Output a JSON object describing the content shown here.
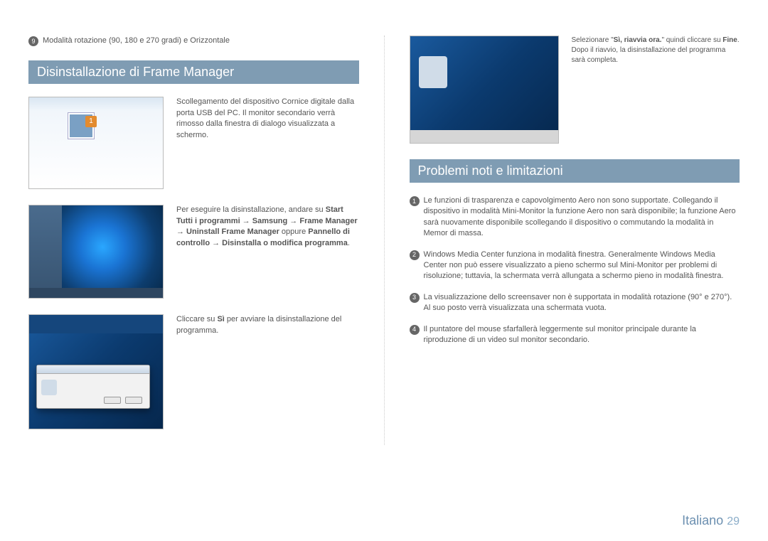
{
  "left": {
    "rotation_item": {
      "num": "9",
      "text": "Modalità rotazione (90, 180 e 270 gradi) e Orizzontale"
    },
    "section_title": "Disinstallazione di Frame Manager",
    "row1_text": "Scollegamento del dispositivo Cornice digitale dalla porta USB del PC. Il monitor secondario verrà rimosso dalla finestra di dialogo visualizzata a schermo.",
    "row2_plain1": "Per eseguire la disinstallazione, andare su ",
    "row2_bold1": "Start Tutti i programmi → Samsung → Frame Manager → Uninstall Frame Manager",
    "row2_plain2": " oppure ",
    "row2_bold2": "Pannello di controllo → Disinstalla o modifica programma",
    "row2_plain3": ".",
    "row3_plain1": "Cliccare su ",
    "row3_bold1": "Sì",
    "row3_plain2": " per avviare la disinstallazione del programma."
  },
  "right": {
    "top_plain1": "Selezionare \"",
    "top_bold1": "Sì, riavvia ora.",
    "top_plain2": "\" quindi cliccare su ",
    "top_bold2": "Fine",
    "top_plain3": ". Dopo il riavvio, la disinstallazione del programma sarà completa.",
    "section_title": "Problemi noti e limitazioni",
    "items": [
      {
        "num": "1",
        "text": "Le funzioni di trasparenza e capovolgimento Aero non sono supportate. Collegando il dispositivo in modalità Mini-Monitor la funzione Aero non sarà disponibile; la funzione Aero sarà nuovamente disponibile scollegando il dispositivo o commutando la modalità in Memor di massa."
      },
      {
        "num": "2",
        "text": "Windows Media Center funziona in modalità finestra. Generalmente Windows Media Center non può essere visualizzato a pieno schermo sul Mini-Monitor per problemi di risoluzione; tuttavia, la schermata verrà allungata a schermo pieno in modalità finestra."
      },
      {
        "num": "3",
        "text": "La visualizzazione dello screensaver non è supportata in modalità rotazione (90° e 270°). Al suo posto verrà visualizzata una schermata vuota."
      },
      {
        "num": "4",
        "text": "Il puntatore del mouse sfarfallerà leggermente sul monitor principale durante la riproduzione di un video sul monitor secondario."
      }
    ]
  },
  "footer": {
    "lang": "Italiano",
    "page": "29"
  }
}
